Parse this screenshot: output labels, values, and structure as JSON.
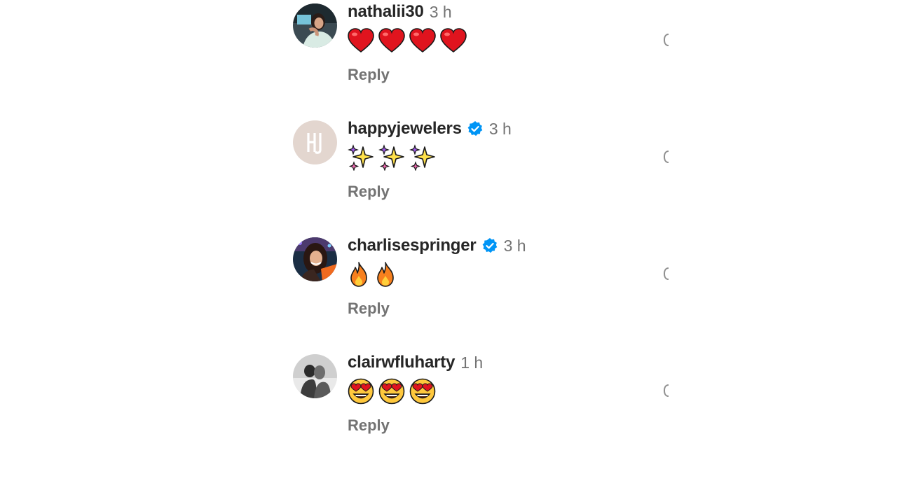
{
  "comments": [
    {
      "username": "nathalii30",
      "verified": false,
      "time": "3 h",
      "emojis": [
        "heart",
        "heart",
        "heart",
        "heart"
      ],
      "reply_label": "Reply"
    },
    {
      "username": "happyjewelers",
      "verified": true,
      "time": "3 h",
      "emojis": [
        "sparkles",
        "sparkles",
        "sparkles"
      ],
      "reply_label": "Reply",
      "avatar_monogram": "HJ"
    },
    {
      "username": "charlisespringer",
      "verified": true,
      "time": "3 h",
      "emojis": [
        "fire",
        "fire"
      ],
      "reply_label": "Reply"
    },
    {
      "username": "clairwfluharty",
      "verified": false,
      "time": "1 h",
      "emojis": [
        "heart-eyes",
        "heart-eyes",
        "heart-eyes"
      ],
      "reply_label": "Reply"
    }
  ],
  "colors": {
    "username": "#262626",
    "muted": "#737373",
    "verified_blue": "#0095f6",
    "heart_red": "#e0141e"
  },
  "icons": {
    "verified": "verified-badge-icon",
    "like": "heart-outline-icon"
  }
}
